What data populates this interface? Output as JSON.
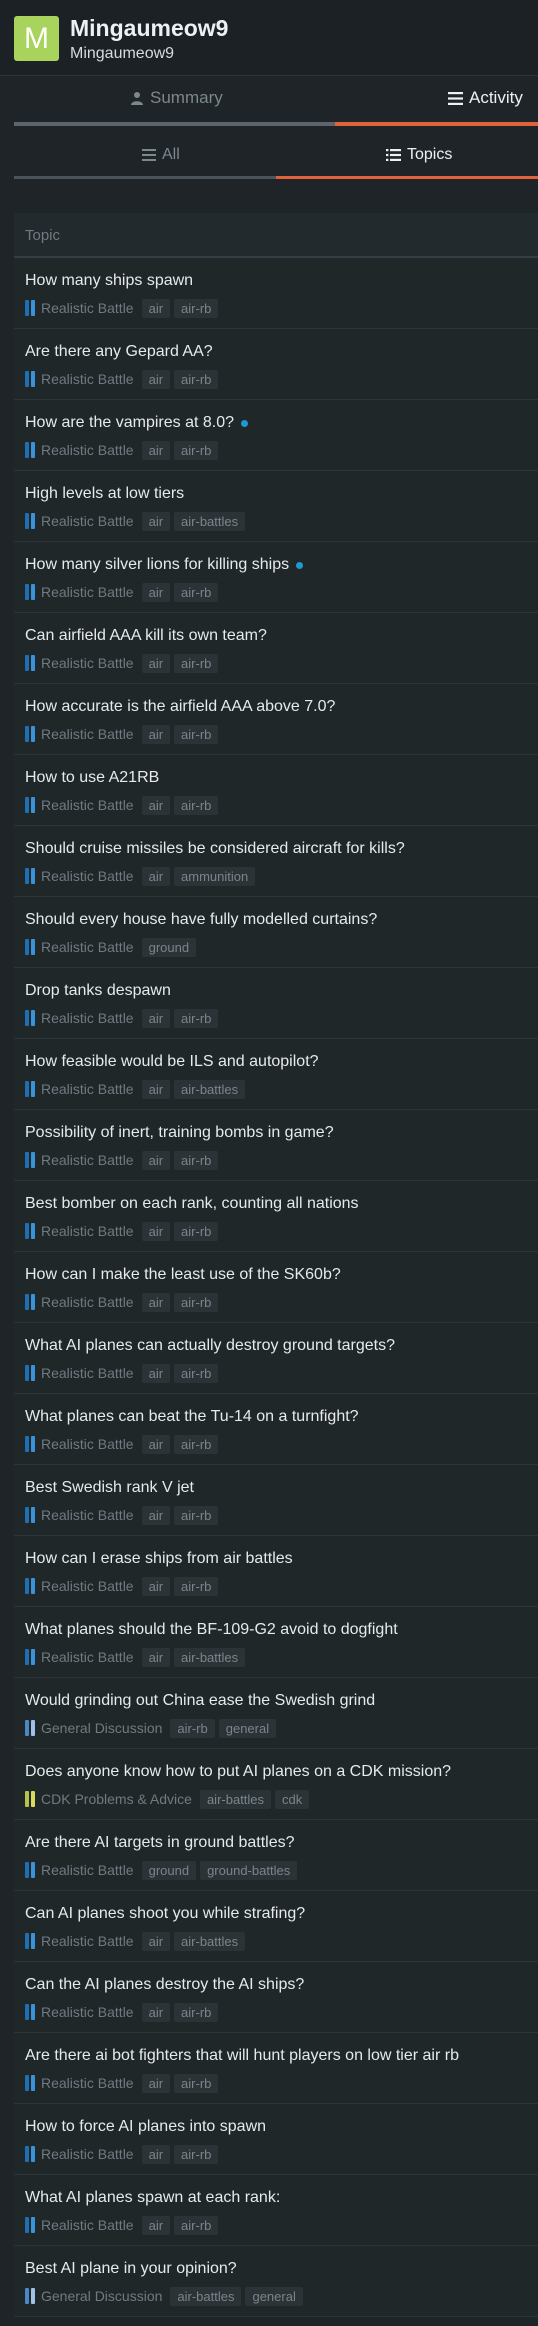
{
  "user": {
    "avatar_letter": "M",
    "display_name": "Mingaumeow9",
    "username": "Mingaumeow9"
  },
  "main_tabs": [
    {
      "label": "Summary",
      "icon": "user-icon",
      "active": false
    },
    {
      "label": "Activity",
      "icon": "list-icon",
      "active": true
    }
  ],
  "sub_tabs": [
    {
      "label": "All",
      "icon": "list-icon",
      "active": false
    },
    {
      "label": "Topics",
      "icon": "list-ul-icon",
      "active": true
    }
  ],
  "table": {
    "header": "Topic",
    "rows": [
      {
        "title": "How many ships spawn",
        "category": "Realistic Battle",
        "tags": [
          "air",
          "air-rb"
        ],
        "unread": false
      },
      {
        "title": "Are there any Gepard AA?",
        "category": "Realistic Battle",
        "tags": [
          "air",
          "air-rb"
        ],
        "unread": false
      },
      {
        "title": "How are the vampires at 8.0?",
        "category": "Realistic Battle",
        "tags": [
          "air",
          "air-rb"
        ],
        "unread": true
      },
      {
        "title": "High levels at low tiers",
        "category": "Realistic Battle",
        "tags": [
          "air",
          "air-battles"
        ],
        "unread": false
      },
      {
        "title": "How many silver lions for killing ships",
        "category": "Realistic Battle",
        "tags": [
          "air",
          "air-rb"
        ],
        "unread": true
      },
      {
        "title": "Can airfield AAA kill its own team?",
        "category": "Realistic Battle",
        "tags": [
          "air",
          "air-rb"
        ],
        "unread": false
      },
      {
        "title": "How accurate is the airfield AAA above 7.0?",
        "category": "Realistic Battle",
        "tags": [
          "air",
          "air-rb"
        ],
        "unread": false
      },
      {
        "title": "How to use A21RB",
        "category": "Realistic Battle",
        "tags": [
          "air",
          "air-rb"
        ],
        "unread": false
      },
      {
        "title": "Should cruise missiles be considered aircraft for kills?",
        "category": "Realistic Battle",
        "tags": [
          "air",
          "ammunition"
        ],
        "unread": false
      },
      {
        "title": "Should every house have fully modelled curtains?",
        "category": "Realistic Battle",
        "tags": [
          "ground"
        ],
        "unread": false
      },
      {
        "title": "Drop tanks despawn",
        "category": "Realistic Battle",
        "tags": [
          "air",
          "air-rb"
        ],
        "unread": false
      },
      {
        "title": "How feasible would be ILS and autopilot?",
        "category": "Realistic Battle",
        "tags": [
          "air",
          "air-battles"
        ],
        "unread": false
      },
      {
        "title": "Possibility of inert, training bombs in game?",
        "category": "Realistic Battle",
        "tags": [
          "air",
          "air-rb"
        ],
        "unread": false
      },
      {
        "title": "Best bomber on each rank, counting all nations",
        "category": "Realistic Battle",
        "tags": [
          "air",
          "air-rb"
        ],
        "unread": false
      },
      {
        "title": "How can I make the least use of the SK60b?",
        "category": "Realistic Battle",
        "tags": [
          "air",
          "air-rb"
        ],
        "unread": false
      },
      {
        "title": "What AI planes can actually destroy ground targets?",
        "category": "Realistic Battle",
        "tags": [
          "air",
          "air-rb"
        ],
        "unread": false
      },
      {
        "title": "What planes can beat the Tu-14 on a turnfight?",
        "category": "Realistic Battle",
        "tags": [
          "air",
          "air-rb"
        ],
        "unread": false
      },
      {
        "title": "Best Swedish rank V jet",
        "category": "Realistic Battle",
        "tags": [
          "air",
          "air-rb"
        ],
        "unread": false
      },
      {
        "title": "How can I erase ships from air battles",
        "category": "Realistic Battle",
        "tags": [
          "air",
          "air-rb"
        ],
        "unread": false
      },
      {
        "title": "What planes should the BF-109-G2 avoid to dogfight",
        "category": "Realistic Battle",
        "tags": [
          "air",
          "air-battles"
        ],
        "unread": false
      },
      {
        "title": "Would grinding out China ease the Swedish grind",
        "category": "General Discussion",
        "tags": [
          "air-rb",
          "general"
        ],
        "unread": false
      },
      {
        "title": "Does anyone know how to put AI planes on a CDK mission?",
        "category": "CDK Problems & Advice",
        "tags": [
          "air-battles",
          "cdk"
        ],
        "unread": false
      },
      {
        "title": "Are there AI targets in ground battles?",
        "category": "Realistic Battle",
        "tags": [
          "ground",
          "ground-battles"
        ],
        "unread": false
      },
      {
        "title": "Can AI planes shoot you while strafing?",
        "category": "Realistic Battle",
        "tags": [
          "air",
          "air-battles"
        ],
        "unread": false
      },
      {
        "title": "Can the AI planes destroy the AI ships?",
        "category": "Realistic Battle",
        "tags": [
          "air",
          "air-rb"
        ],
        "unread": false
      },
      {
        "title": "Are there ai bot fighters that will hunt players on low tier air rb",
        "category": "Realistic Battle",
        "tags": [
          "air",
          "air-rb"
        ],
        "unread": false
      },
      {
        "title": "How to force AI planes into spawn",
        "category": "Realistic Battle",
        "tags": [
          "air",
          "air-rb"
        ],
        "unread": false
      },
      {
        "title": "What AI planes spawn at each rank:",
        "category": "Realistic Battle",
        "tags": [
          "air",
          "air-rb"
        ],
        "unread": false
      },
      {
        "title": "Best AI plane in your opinion?",
        "category": "General Discussion",
        "tags": [
          "air-battles",
          "general"
        ],
        "unread": false
      }
    ]
  },
  "colors": {
    "accent": "#e0623a",
    "avatar": "#a8d45e",
    "unread_dot": "#1d9ad6",
    "cat_realistic_a": "#1f6fb4",
    "cat_realistic_b": "#3a93d6",
    "cat_general_a": "#4a88c8",
    "cat_general_b": "#9fc3e6",
    "cat_cdk_a": "#b6c24a",
    "cat_cdk_b": "#d6dc5a"
  }
}
